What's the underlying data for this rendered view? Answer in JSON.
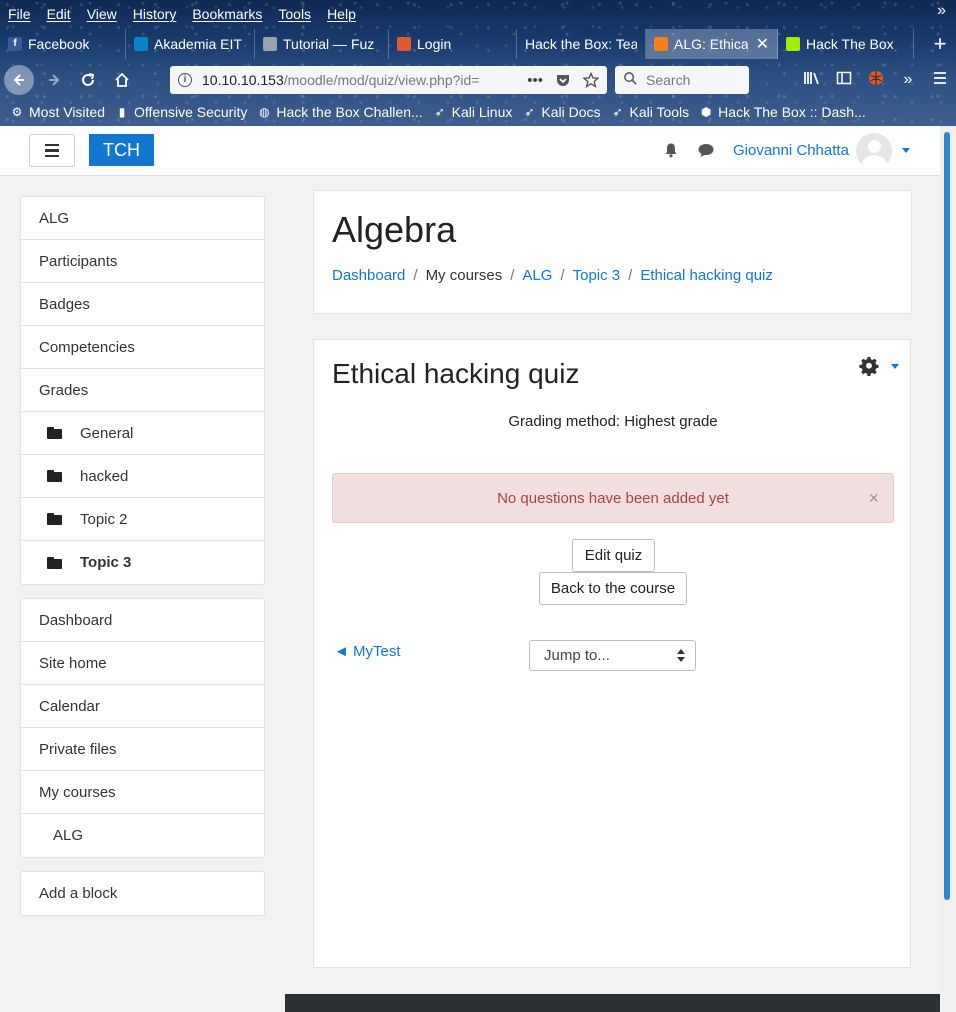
{
  "browser": {
    "menu": [
      "File",
      "Edit",
      "View",
      "History",
      "Bookmarks",
      "Tools",
      "Help"
    ],
    "tabs": [
      {
        "label": "Facebook",
        "icon": "facebook-icon",
        "color": "#3b5998"
      },
      {
        "label": "Akademia EIT",
        "icon": "akademia-icon",
        "color": "#0a84c6"
      },
      {
        "label": "Tutorial — Fuz",
        "icon": "page-icon",
        "color": "#9aa3ad"
      },
      {
        "label": "Login",
        "icon": "login-icon",
        "color": "#e0582b"
      },
      {
        "label": "Hack the Box: Tea",
        "icon": "",
        "color": ""
      },
      {
        "label": "ALG: Ethica",
        "icon": "moodle-icon",
        "color": "#f98012"
      },
      {
        "label": "Hack The Box",
        "icon": "htb-icon",
        "color": "#9fef00"
      }
    ],
    "url_host": "10.10.10.153",
    "url_path": "/moodle/mod/quiz/view.php?id=",
    "search_placeholder": "Search",
    "bookmarks": [
      {
        "label": "Most Visited",
        "icon": "gear-icon"
      },
      {
        "label": "Offensive Security",
        "icon": "offsec-icon"
      },
      {
        "label": "Hack the Box Challen...",
        "icon": "globe-icon"
      },
      {
        "label": "Kali Linux",
        "icon": "kali-icon"
      },
      {
        "label": "Kali Docs",
        "icon": "kali-icon"
      },
      {
        "label": "Kali Tools",
        "icon": "kali-icon"
      },
      {
        "label": "Hack The Box :: Dash...",
        "icon": "htb-icon"
      }
    ]
  },
  "moodle": {
    "brand": "TCH",
    "user_name": "Giovanni Chhatta",
    "nav_course": [
      {
        "label": "ALG",
        "level": 0,
        "bold": false
      },
      {
        "label": "Participants",
        "level": 0,
        "bold": false
      },
      {
        "label": "Badges",
        "level": 0,
        "bold": false
      },
      {
        "label": "Competencies",
        "level": 0,
        "bold": false
      },
      {
        "label": "Grades",
        "level": 0,
        "bold": false
      },
      {
        "label": "General",
        "level": 1,
        "bold": false
      },
      {
        "label": "hacked",
        "level": 1,
        "bold": false
      },
      {
        "label": "Topic 2",
        "level": 1,
        "bold": false
      },
      {
        "label": "Topic 3",
        "level": 1,
        "bold": true
      }
    ],
    "nav_site": [
      {
        "label": "Dashboard",
        "level": 0
      },
      {
        "label": "Site home",
        "level": 0
      },
      {
        "label": "Calendar",
        "level": 0
      },
      {
        "label": "Private files",
        "level": 0
      },
      {
        "label": "My courses",
        "level": 0
      },
      {
        "label": "ALG",
        "level": 2
      }
    ],
    "add_block": "Add a block",
    "course_title": "Algebra",
    "breadcrumb": [
      {
        "label": "Dashboard",
        "link": true
      },
      {
        "label": "My courses",
        "link": false
      },
      {
        "label": "ALG",
        "link": true
      },
      {
        "label": "Topic 3",
        "link": true
      },
      {
        "label": "Ethical hacking quiz",
        "link": true
      }
    ],
    "quiz_title": "Ethical hacking quiz",
    "grading_method": "Grading method: Highest grade",
    "alert": "No questions have been added yet",
    "edit_quiz": "Edit quiz",
    "back_to_course": "Back to the course",
    "prev_link": "◄ MyTest",
    "jump_to": "Jump to..."
  }
}
